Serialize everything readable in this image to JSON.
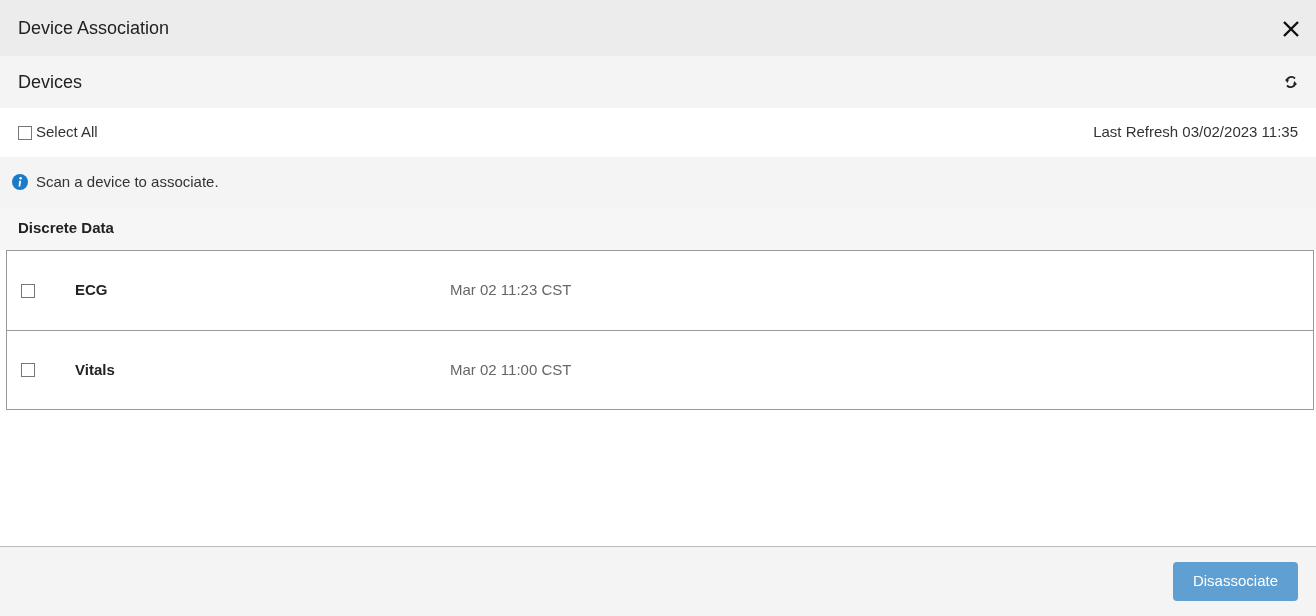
{
  "window": {
    "title": "Device Association"
  },
  "section": {
    "title": "Devices"
  },
  "select_all": {
    "label": "Select All",
    "checked": false
  },
  "last_refresh": "Last Refresh 03/02/2023 11:35",
  "info": "Scan a device to associate.",
  "group": {
    "title": "Discrete Data"
  },
  "rows": [
    {
      "name": "ECG",
      "time": "Mar 02 11:23 CST",
      "checked": false
    },
    {
      "name": "Vitals",
      "time": "Mar 02 11:00 CST",
      "checked": false
    }
  ],
  "footer": {
    "button": {
      "label": "Disassociate",
      "disabled": true
    }
  }
}
